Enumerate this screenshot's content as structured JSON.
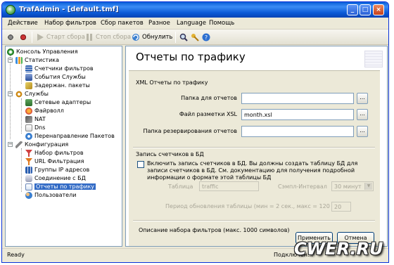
{
  "window": {
    "title": "TrafAdmin - [default.tmf]"
  },
  "menu": [
    "Действие",
    "Набор фильтров",
    "Сбор пакетов",
    "Разное",
    "Language",
    "Помощь"
  ],
  "toolbar": {
    "start": "Старт сбора",
    "stop": "Стоп сбора",
    "refresh": "Обнулить"
  },
  "tree": {
    "root": "Консоль Управления",
    "statistics": "Статистика",
    "counters": "Счетчики фильтров",
    "events": "События Службы",
    "delayed": "Задержан. пакеты",
    "services": "Службы",
    "adapters": "Сетевые адаптеры",
    "firewall": "Файрволл",
    "nat": "NAT",
    "dns": "Dns",
    "redirect": "Перенаправление Пакетов",
    "config": "Конфигурация",
    "filterset": "Набор фильтров",
    "url": "URL Фильтрация",
    "ipgroups": "Группы IP адресов",
    "db": "Соединение с БД",
    "reports": "Отчеты по трафику",
    "users": "Пользователи"
  },
  "main": {
    "title": "Отчеты по трафику",
    "xml_section": "XML Отчеты по трафику",
    "reports_folder_label": "Папка для отчетов",
    "reports_folder_value": "",
    "xsl_label": "Файл разметки XSL",
    "xsl_value": "month.xsl",
    "backup_folder_label": "Папка резервирования отчетов",
    "backup_folder_value": "",
    "browse": "...",
    "db_section": "Запись счетчиков в БД",
    "db_checkbox_text": "Включить запись счетчиков в БД. Вы должны создать таблицу БД для записи счетчиков в БД. См. документацию для получения подробной информации о формате этой таблицы БД",
    "table_label": "Таблица",
    "table_value": "traffic",
    "interval_label": "Сэмпл-Интервал",
    "interval_value": "30 минут",
    "update_label": "Период обновления таблицы (мин = 2 сек., макс = 120 сек.)",
    "update_value": "20",
    "filter_desc": "Описание набора фильтров (макс. 1000 символов)",
    "apply": "Применить",
    "cancel": "Отмена"
  },
  "status": {
    "ready": "Ready",
    "connection": "Подключен..."
  },
  "watermark": "CWER.RU"
}
